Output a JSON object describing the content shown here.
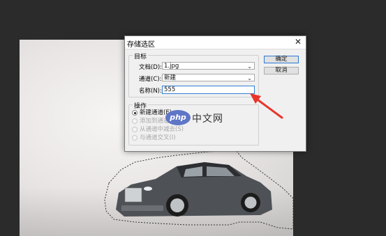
{
  "dialog": {
    "title": "存储选区",
    "close_glyph": "✕",
    "target_group": {
      "title": "目标",
      "document_label": "文档(D):",
      "document_value": "1.jpg",
      "channel_label": "通道(C):",
      "channel_value": "新建",
      "name_label": "名称(N):",
      "name_value": "555"
    },
    "operation_group": {
      "title": "操作",
      "options": [
        {
          "label": "新建通道(E)",
          "checked": true,
          "enabled": true
        },
        {
          "label": "添加到通道",
          "checked": false,
          "enabled": false
        },
        {
          "label": "从通道中减去(S)",
          "checked": false,
          "enabled": false
        },
        {
          "label": "与通道交叉(I)",
          "checked": false,
          "enabled": false
        }
      ]
    },
    "ok_label": "确定",
    "cancel_label": "取消"
  },
  "watermark": {
    "logo_text": "php",
    "text": "中文网"
  },
  "icons": {
    "dropdown": "chevron-down-icon",
    "close": "close-icon",
    "annotation": "red-arrow-icon"
  },
  "colors": {
    "workspace": "#2b2b2b",
    "dialog_bg": "#f0f0f0",
    "focus_border": "#2f7fd6",
    "arrow": "#e8352b",
    "watermark_badge": "#5f76c7"
  }
}
